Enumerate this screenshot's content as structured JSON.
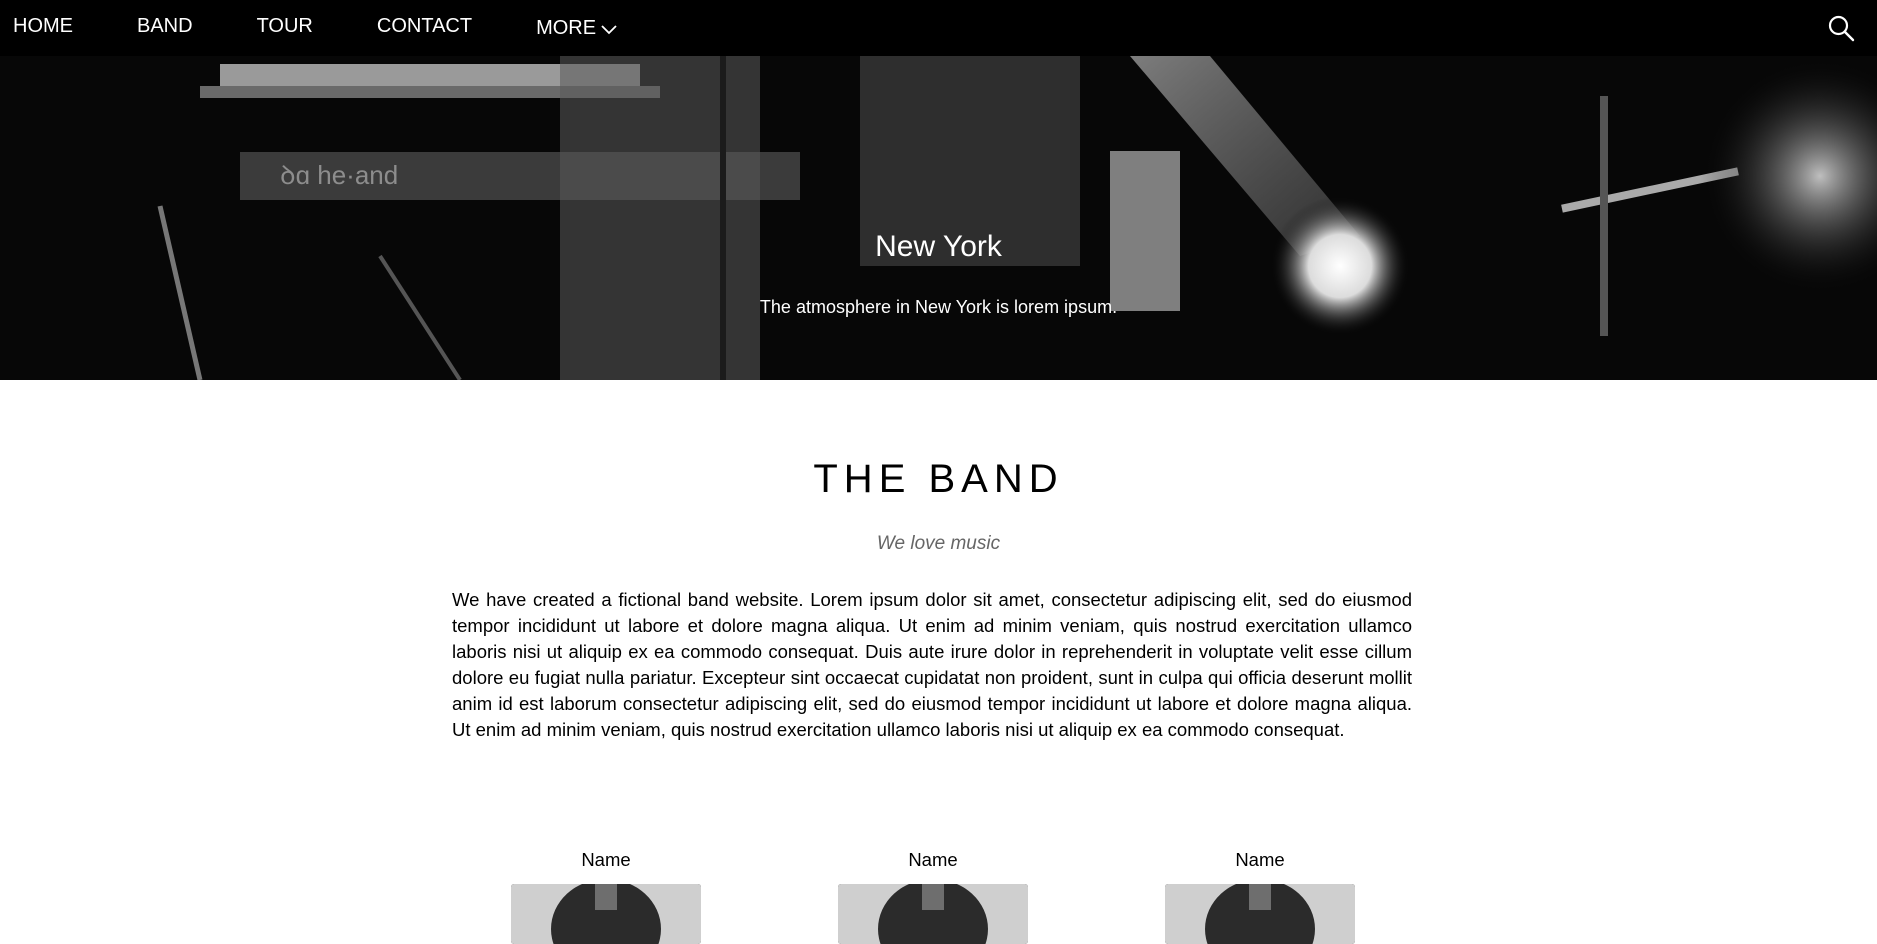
{
  "nav": {
    "items": [
      "HOME",
      "BAND",
      "TOUR",
      "CONTACT"
    ],
    "more_label": "MORE",
    "more_icon": "chevron-down-icon",
    "search_icon": "search-icon"
  },
  "hero": {
    "title": "New York",
    "subtitle": "The atmosphere in New York is lorem ipsum."
  },
  "band": {
    "heading": "THE BAND",
    "tagline": "We love music",
    "description": "We have created a fictional band website. Lorem ipsum dolor sit amet, consectetur adipiscing elit, sed do eiusmod tempor incididunt ut labore et dolore magna aliqua. Ut enim ad minim veniam, quis nostrud exercitation ullamco laboris nisi ut aliquip ex ea commodo consequat. Duis aute irure dolor in reprehenderit in voluptate velit esse cillum dolore eu fugiat nulla pariatur. Excepteur sint occaecat cupidatat non proident, sunt in culpa qui officia deserunt mollit anim id est laborum consectetur adipiscing elit, sed do eiusmod tempor incididunt ut labore et dolore magna aliqua. Ut enim ad minim veniam, quis nostrud exercitation ullamco laboris nisi ut aliquip ex ea commodo consequat.",
    "members": [
      {
        "name": "Name"
      },
      {
        "name": "Name"
      },
      {
        "name": "Name"
      }
    ]
  }
}
